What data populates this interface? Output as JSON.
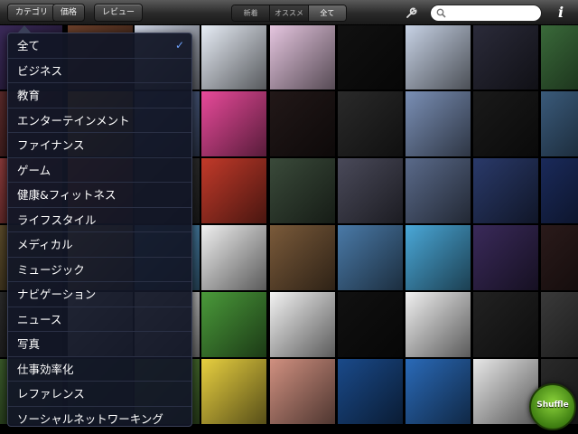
{
  "toolbar": {
    "category_label": "カテゴリ",
    "price_label": "価格",
    "review_label": "レビュー",
    "segments": [
      "新着",
      "オススメ",
      "全て"
    ],
    "active_segment": 2,
    "search_placeholder": "",
    "info_label": "i"
  },
  "dropdown": {
    "selected_index": 0,
    "items": [
      "全て",
      "ビジネス",
      "教育",
      "エンターテインメント",
      "ファイナンス",
      "ゲーム",
      "健康&フィットネス",
      "ライフスタイル",
      "メディカル",
      "ミュージック",
      "ナビゲーション",
      "ニュース",
      "写真",
      "仕事効率化",
      "レファレンス",
      "ソーシャルネットワーキング"
    ]
  },
  "shuffle": {
    "label": "Shuffle"
  },
  "colors": {
    "accent_check": "#6fa3ff",
    "shuffle_green": "#5ea823",
    "dropdown_bg": "#12162a"
  },
  "mosaic": {
    "columns": 9,
    "rows": 6,
    "tile_colors": [
      "#3b2a5a",
      "#6b3f2a",
      "#cfd6e6",
      "#e8eef7",
      "#e6c6e0",
      "#111111",
      "#c8d3e6",
      "#2b2b3a",
      "#3a6a3a",
      "#5a2a2a",
      "#e0a030",
      "#5a6e9a",
      "#e84a9a",
      "#221818",
      "#2a2a2a",
      "#7a8fb5",
      "#1a1a1a",
      "#3a5a7a",
      "#8a3a3a",
      "#d85a2a",
      "#3a3a3a",
      "#c23a2a",
      "#3a4a3a",
      "#4a4a5a",
      "#5a6a8a",
      "#2a3a6a",
      "#1a2a5a",
      "#5a4a2a",
      "#e0c080",
      "#5aa0d0",
      "#f0f0f0",
      "#7a5a3a",
      "#4a7aa8",
      "#4aa8d8",
      "#3a2a5a",
      "#2a1a1a",
      "#2a2a2a",
      "#f4f4f4",
      "#eeeeee",
      "#4a9a3a",
      "#f2f2f2",
      "#111111",
      "#f0f0f0",
      "#222222",
      "#3a3a3a",
      "#3a5a2a",
      "#2a4a2a",
      "#5a8a3a",
      "#e8d040",
      "#d09080",
      "#1a4a8a",
      "#2a6ab8",
      "#e8e8e8",
      "#2a2a2a"
    ]
  }
}
